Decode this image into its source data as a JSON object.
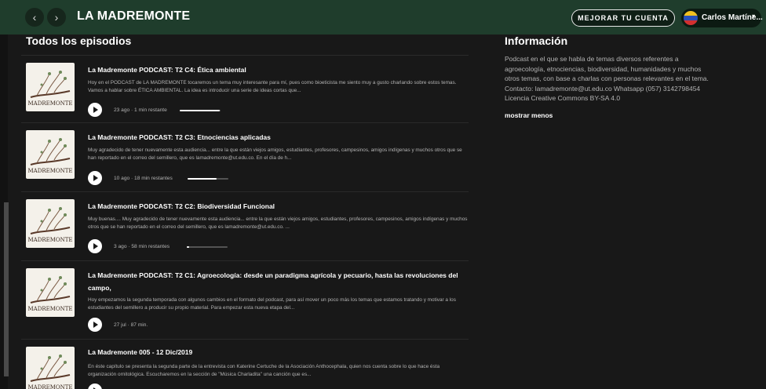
{
  "header": {
    "back_icon": "‹",
    "forward_icon": "›",
    "title": "LA MADREMONTE",
    "upgrade_label": "MEJORAR TU CUENTA",
    "user_name": "Carlos Martíne...",
    "user_caret": "▾"
  },
  "episodes_section": {
    "title": "Todos los episodios",
    "thumb_text": "MADREMONTE",
    "items": [
      {
        "title": "La Madremonte PODCAST: T2 C4: Ética ambiental",
        "description": "Hoy en el PODCAST de LA MADREMONTE tocaremos un tema muy interesante para mí, pues como bioeticista me siento muy a gusto charlando sobre estos temas. Vamos a hablar sobre ÉTICA AMBIENTAL. La idea es introducir una serie de ideas cortas que...",
        "meta": "23 ago · 1 min restante",
        "progress": 0.98
      },
      {
        "title": "La Madremonte PODCAST: T2 C3: Etnociencias aplicadas",
        "description": "Muy agradecido de tener nuevamente esta audiencia... entre la que están viejos amigos, estudiantes, profesores, campesinos, amigos indígenas y muchos otros que se han reportado en el correo del semillero, que es lamadremonte@ut.edu.co. En el día de h...",
        "meta": "10 ago · 18 min restantes",
        "progress": 0.72
      },
      {
        "title": "La Madremonte PODCAST: T2 C2: Biodiversidad Funcional",
        "description": "Muy buenas.... Muy agradecido de tener nuevamente esta audiencia... entre la que están viejos amigos, estudiantes, profesores, campesinos, amigos indígenas y muchos otros que se han reportado en el correo del semillero, que es lamadremonte@ut.edu.co. ...",
        "meta": "3 ago · 58 min restantes",
        "progress": 0.06
      },
      {
        "title": "La Madremonte PODCAST: T2 C1: Agroecología: desde un paradigma agrícola y pecuario, hasta las revoluciones del campo,",
        "description": "Hoy empezamos la segunda temporada con algunos cambios en el formato del podcast, para así mover un poco más los temas que estamos tratando y motivar a los estudiantes del semillero a producir su propio material. Para empezar esta nueva etapa del...",
        "meta": "27 jul · 87 min."
      },
      {
        "title": "La Madremonte 005 - 12 Dic/2019",
        "description": "En éste capítulo se presenta la segunda parte de la entrevista con Katerine Certuche de la Asociación Anthocephala, quien nos cuenta sobre lo que hace ésta organización ornitológica. Escucharemos en la sección de \"Música Charladita\" una canción que es...",
        "meta": ""
      }
    ]
  },
  "info": {
    "title": "Información",
    "description_lines": [
      "Podcast en el que se habla de temas diversos referentes a",
      "agroecología, etnociencias, biodiversidad, humanidades y muchos",
      "otros temas, con base a charlas con personas relevantes en el tema.",
      "Contacto: lamadremonte@ut.edu.co Whatsapp (057) 3142798454",
      "Licencia Creative Commons BY-SA 4.0"
    ],
    "toggle_label": "mostrar menos"
  },
  "colors": {
    "header_bg": "#1f3d2c",
    "page_bg": "#181818",
    "secondary_text": "#b3b3b3"
  }
}
